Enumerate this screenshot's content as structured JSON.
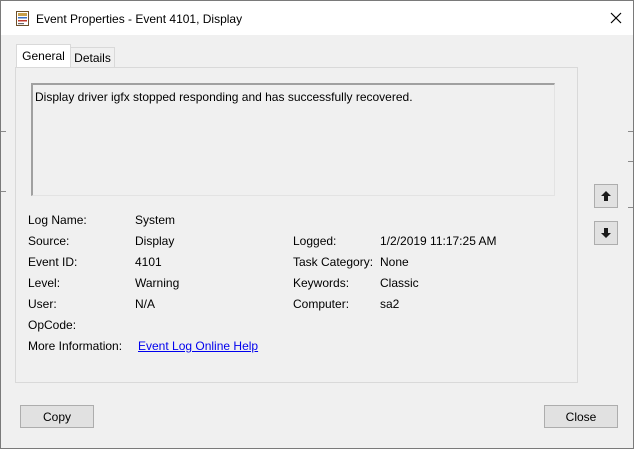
{
  "window": {
    "title": "Event Properties - Event 4101, Display"
  },
  "tabs": [
    {
      "label": "General"
    },
    {
      "label": "Details"
    }
  ],
  "description": "Display driver igfx stopped responding and has successfully recovered.",
  "fields_left": [
    {
      "label": "Log Name:",
      "value": "System"
    },
    {
      "label": "Source:",
      "value": "Display"
    },
    {
      "label": "Event ID:",
      "value": "4101"
    },
    {
      "label": "Level:",
      "value": "Warning"
    },
    {
      "label": "User:",
      "value": "N/A"
    },
    {
      "label": "OpCode:",
      "value": ""
    }
  ],
  "fields_right": [
    {
      "label": "Logged:",
      "value": "1/2/2019 11:17:25 AM"
    },
    {
      "label": "Task Category:",
      "value": "None"
    },
    {
      "label": "Keywords:",
      "value": "Classic"
    },
    {
      "label": "Computer:",
      "value": "sa2"
    }
  ],
  "more_info": {
    "label": "More Information:",
    "link": "Event Log Online Help"
  },
  "buttons": {
    "copy": "Copy",
    "close": "Close"
  },
  "icons": {
    "title": "event-viewer-icon",
    "close": "close-icon",
    "up": "arrow-up-icon",
    "down": "arrow-down-icon"
  }
}
